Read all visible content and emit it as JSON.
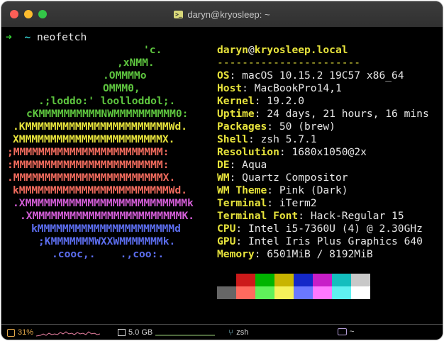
{
  "window": {
    "title": "daryn@kryosleep: ~",
    "title_icon": "terminal-icon"
  },
  "prompt": {
    "arrow": "➜",
    "dir": "~",
    "command": "neofetch"
  },
  "ascii_art": [
    {
      "text": "'c.",
      "color": "#5ec63f"
    },
    {
      "text": ",xNMM.",
      "color": "#5ec63f"
    },
    {
      "text": ".OMMMMo",
      "color": "#5ec63f"
    },
    {
      "text": "OMMM0,",
      "color": "#5ec63f"
    },
    {
      "text": ".;loddo:' loolloddol;.",
      "color": "#5ec63f"
    },
    {
      "text": "cKMMMMMMMMMMNWMMMMMMMMMM0:",
      "color": "#5ec63f"
    },
    {
      "text": ".KMMMMMMMMMMMMMMMMMMMMMMMWd.",
      "color": "#e8e43c"
    },
    {
      "text": "XMMMMMMMMMMMMMMMMMMMMMMMX.",
      "color": "#e8e43c"
    },
    {
      "text": ";MMMMMMMMMMMMMMMMMMMMMMMM:",
      "color": "#f36c5e"
    },
    {
      "text": ":MMMMMMMMMMMMMMMMMMMMMMMM:",
      "color": "#f36c5e"
    },
    {
      "text": ".MMMMMMMMMMMMMMMMMMMMMMMMX.",
      "color": "#f36c5e"
    },
    {
      "text": "kMMMMMMMMMMMMMMMMMMMMMMMMWd.",
      "color": "#f36c5e"
    },
    {
      "text": ".XMMMMMMMMMMMMMMMMMMMMMMMMMMk",
      "color": "#d45ed8"
    },
    {
      "text": ".XMMMMMMMMMMMMMMMMMMMMMMMMK.",
      "color": "#d45ed8"
    },
    {
      "text": "kMMMMMMMMMMMMMMMMMMMMMMd",
      "color": "#5c6ef0"
    },
    {
      "text": ";KMMMMMMMWXXWMMMMMMMk.",
      "color": "#5c6ef0"
    },
    {
      "text": ".cooc,.    .,coo:.",
      "color": "#5c6ef0"
    }
  ],
  "info": {
    "user": "daryn",
    "at": "@",
    "host": "kryosleep.local",
    "separator": "-----------------------",
    "rows": [
      {
        "key": "OS",
        "value": "macOS 10.15.2 19C57 x86_64"
      },
      {
        "key": "Host",
        "value": "MacBookPro14,1"
      },
      {
        "key": "Kernel",
        "value": "19.2.0"
      },
      {
        "key": "Uptime",
        "value": "24 days, 21 hours, 16 mins"
      },
      {
        "key": "Packages",
        "value": "50 (brew)"
      },
      {
        "key": "Shell",
        "value": "zsh 5.7.1"
      },
      {
        "key": "Resolution",
        "value": "1680x1050@2x"
      },
      {
        "key": "DE",
        "value": "Aqua"
      },
      {
        "key": "WM",
        "value": "Quartz Compositor"
      },
      {
        "key": "WM Theme",
        "value": "Pink (Dark)"
      },
      {
        "key": "Terminal",
        "value": "iTerm2"
      },
      {
        "key": "Terminal Font",
        "value": "Hack-Regular 15"
      },
      {
        "key": "CPU",
        "value": "Intel i5-7360U (4) @ 2.30GHz"
      },
      {
        "key": "GPU",
        "value": "Intel Iris Plus Graphics 640"
      },
      {
        "key": "Memory",
        "value": "6501MiB / 8192MiB"
      }
    ],
    "colon": ": "
  },
  "color_blocks": {
    "normal": [
      "#000000",
      "#cc1a1a",
      "#00b400",
      "#c8b400",
      "#1428c8",
      "#c81ec8",
      "#14bebe",
      "#c8c8c8"
    ],
    "bright": [
      "#666666",
      "#ff6a5e",
      "#5ff05a",
      "#f5f05a",
      "#6a78ff",
      "#ff78ff",
      "#5ff0f0",
      "#ffffff"
    ]
  },
  "status_bar": {
    "cpu_icon": "cpu-icon",
    "cpu": "31%",
    "memory_icon": "memory-icon",
    "memory": "5.0 GB",
    "branch_icon": "branch-icon",
    "shell": "zsh",
    "folder_icon": "folder-icon",
    "dir": "~",
    "accent_cpu": "#e4a84a",
    "accent_folder": "#b49ed8"
  }
}
